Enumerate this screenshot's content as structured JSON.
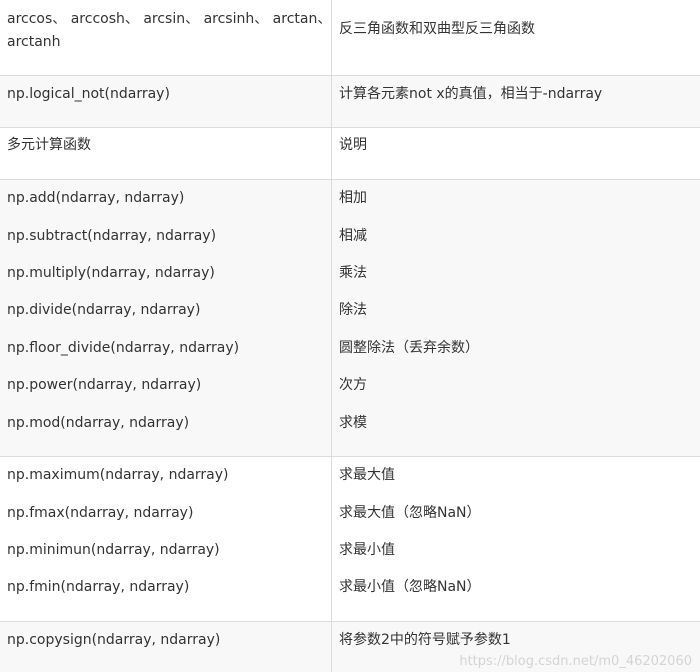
{
  "rows": [
    {
      "lines": [
        {
          "left": "arccos、 arccosh、 arcsin、 arcsinh、 arctan、",
          "right": "反三角函数和双曲型反三角函数"
        },
        {
          "left": "arctanh",
          "right": ""
        }
      ]
    },
    {
      "lines": [
        {
          "left": "np.logical_not(ndarray)",
          "right": "计算各元素not x的真值，相当于-ndarray"
        }
      ]
    },
    {
      "lines": [
        {
          "left": "多元计算函数",
          "right": "说明"
        }
      ]
    },
    {
      "lines": [
        {
          "left": "np.add(ndarray, ndarray)",
          "right": "相加"
        },
        {
          "left": "np.subtract(ndarray, ndarray)",
          "right": "相减"
        },
        {
          "left": "np.multiply(ndarray, ndarray)",
          "right": "乘法"
        },
        {
          "left": "np.divide(ndarray, ndarray)",
          "right": "除法"
        },
        {
          "left": "np.floor_divide(ndarray, ndarray)",
          "right": "圆整除法（丢弃余数）"
        },
        {
          "left": "np.power(ndarray, ndarray)",
          "right": "次方"
        },
        {
          "left": "np.mod(ndarray, ndarray)",
          "right": "求模"
        }
      ]
    },
    {
      "lines": [
        {
          "left": "np.maximum(ndarray, ndarray)",
          "right": "求最大值"
        },
        {
          "left": "np.fmax(ndarray, ndarray)",
          "right": "求最大值（忽略NaN）"
        },
        {
          "left": "np.minimun(ndarray, ndarray)",
          "right": "求最小值"
        },
        {
          "left": "np.fmin(ndarray, ndarray)",
          "right": "求最小值（忽略NaN）"
        }
      ]
    },
    {
      "lines": [
        {
          "left": "np.copysign(ndarray, ndarray)",
          "right": "将参数2中的符号赋予参数1"
        }
      ]
    }
  ],
  "watermark": "https://blog.csdn.net/m0_46202060"
}
